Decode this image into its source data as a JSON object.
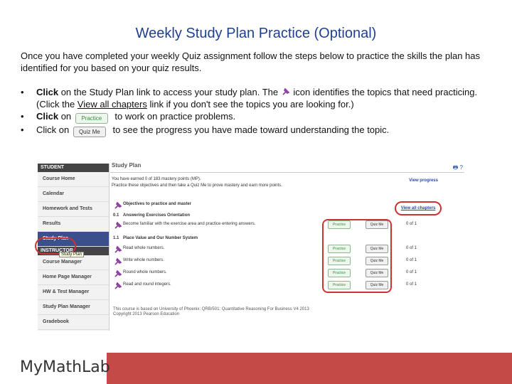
{
  "title": "Weekly Study Plan Practice (Optional)",
  "intro": "Once you have completed your weekly Quiz assignment follow the steps below to practice the skills the plan has identified for you based on your quiz results.",
  "bullets": {
    "b1_bold": "Click",
    "b1_text": " on the Study Plan link to access your study plan. The ",
    "b1_text2": " icon identifies the topics that need practicing. (Click the ",
    "b1_link": "View all chapters",
    "b1_text3": " link if you don't see the topics you are looking for.)",
    "b2_bold": "Click",
    "b2_text": " on ",
    "b2_text2": " to work on practice problems.",
    "b3_text": "Click on ",
    "b3_text2": " to see the progress you have made toward understanding the topic.",
    "practice_label": "Practice",
    "quizme_label": "Quiz Me"
  },
  "shot": {
    "sidebar_head": "STUDENT",
    "sidebar_items": [
      "Course Home",
      "Calendar",
      "Homework and Tests",
      "Results",
      "Study Plan"
    ],
    "instructor_head": "INSTRUCTOR",
    "instructor_items": [
      "Course Manager",
      "Home Page Manager",
      "HW & Test Manager",
      "Study Plan Manager",
      "Gradebook"
    ],
    "tooltip": "Study Plan",
    "header": "Study Plan",
    "tools": "🖶 ?",
    "line1": "You have earned 0 of 183 mastery points (MP).",
    "line2": "Practice these objectives and then take a Quiz Me to prove mastery and earn more points.",
    "view_progress": "View progress",
    "view_all": "View all chapters",
    "objectives_head": "Objectives to practice and master",
    "rows": [
      {
        "sec": "0.1",
        "text": "Answering Exercises Orientation",
        "bold": true
      },
      {
        "sec": "",
        "text": "Become familiar with the exercise area and practice entering answers.",
        "progress": "0 of 1"
      },
      {
        "sec": "1.1",
        "text": "Place Value and Our Number System",
        "bold": true
      },
      {
        "sec": "",
        "text": "Read whole numbers.",
        "progress": "0 of 1"
      },
      {
        "sec": "",
        "text": "Write whole numbers.",
        "progress": "0 of 1"
      },
      {
        "sec": "",
        "text": "Round whole numbers.",
        "progress": "0 of 1"
      },
      {
        "sec": "",
        "text": "Read and round integers.",
        "progress": "0 of 1"
      }
    ],
    "footer1": "This course is based on University of Phoenix: QRB/501: Quantitative Reasoning For Business V4 2013",
    "footer2": "Copyright 2013 Pearson Education"
  },
  "logo_text": "MyMathLab",
  "colors": {
    "title": "#1f3f8f",
    "bar": "#c34a46"
  }
}
